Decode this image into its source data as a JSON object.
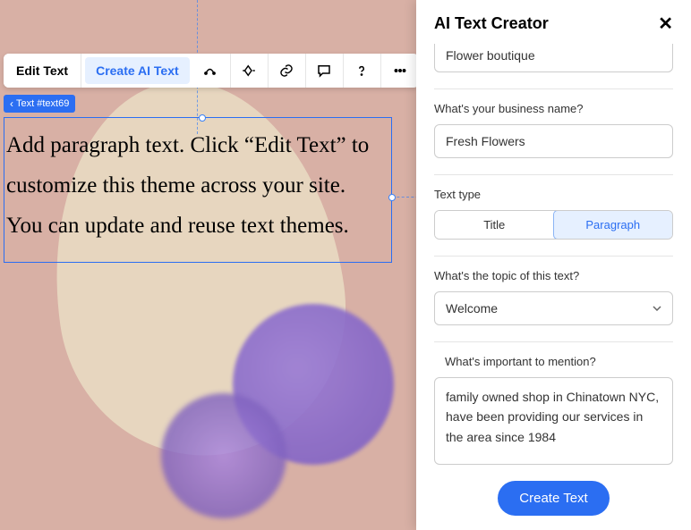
{
  "toolbar": {
    "edit_text": "Edit Text",
    "create_ai_text": "Create AI Text"
  },
  "badge": {
    "label": "Text #text69"
  },
  "textbox": {
    "content": "Add paragraph text. Click “Edit Text” to customize this theme across your site. You can update and reuse text themes."
  },
  "panel": {
    "title": "AI Text Creator",
    "business_type_value": "Flower boutique",
    "business_name_label": "What's your business name?",
    "business_name_value": "Fresh Flowers",
    "text_type_label": "Text type",
    "text_type_options": {
      "title": "Title",
      "paragraph": "Paragraph"
    },
    "text_type_selected": "paragraph",
    "topic_label": "What's the topic of this text?",
    "topic_value": "Welcome",
    "important_label": "What's important to mention?",
    "important_value": "family owned shop in Chinatown NYC, have been providing our services in the area since 1984",
    "create_button": "Create Text"
  }
}
